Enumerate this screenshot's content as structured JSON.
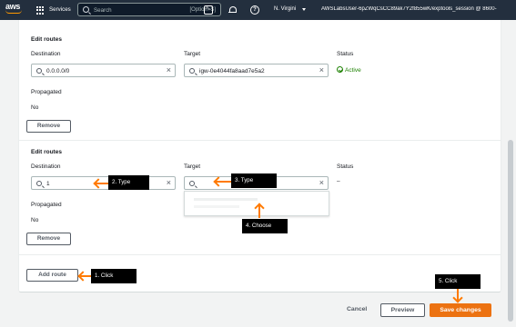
{
  "nav": {
    "logo_text": "aws",
    "services_label": "Services",
    "search_placeholder": "Search",
    "search_shortcut": "[Option+S]",
    "cloudshell_icon": "terminal-icon",
    "bell_icon": "bell-icon",
    "help_icon": "help-icon",
    "help_glyph": "?",
    "region_label": "N. Virgini",
    "account_label": "AWSLabsUser-6pZWqCsCC89ak7Y2f855wK/exptools_session @ 8600-"
  },
  "route1": {
    "heading": "Edit routes",
    "destination_label": "Destination",
    "destination_value": "0.0.0.0/0",
    "target_label": "Target",
    "target_value": "igw-0e4044fa8aad7e5a2",
    "status_label": "Status",
    "status_value": "Active",
    "propagated_label": "Propagated",
    "propagated_value": "No",
    "remove_label": "Remove"
  },
  "route2": {
    "heading": "Edit routes",
    "destination_label": "Destination",
    "destination_value": "1",
    "target_label": "Target",
    "target_value": "",
    "status_label": "Status",
    "status_value": "–",
    "propagated_label": "Propagated",
    "propagated_value": "No",
    "remove_label": "Remove"
  },
  "add_route_label": "Add route",
  "callouts": {
    "c1": "1. Click",
    "c2": "2. Type",
    "c3": "3. Type",
    "c4": "4. Choose",
    "c5": "5. Click"
  },
  "footer": {
    "cancel_label": "Cancel",
    "preview_label": "Preview",
    "save_label": "Save changes"
  },
  "colors": {
    "nav_bg": "#232f3e",
    "accent": "#ec7211",
    "callout_arrow": "#ff7a00",
    "status_active": "#1d8102"
  }
}
